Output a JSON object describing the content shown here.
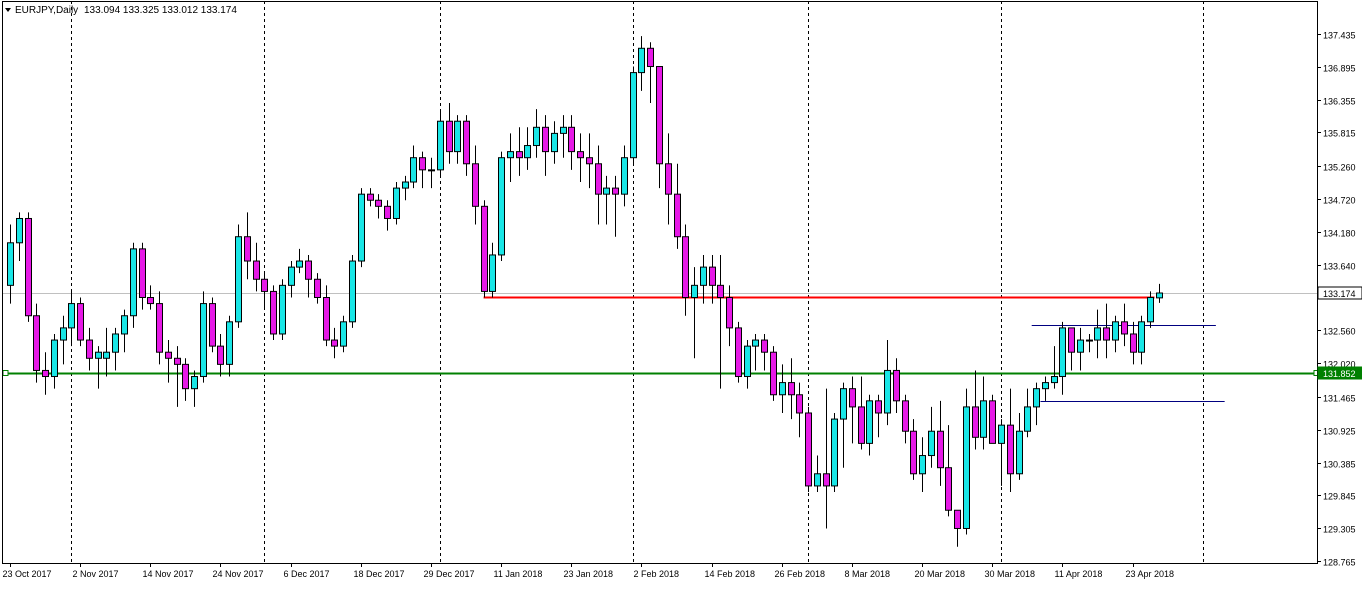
{
  "header": {
    "symbol_label": "EURJPY,Daily",
    "ohlc_label": "133.094 133.325 133.012 133.174"
  },
  "colors": {
    "bull_body": "#19e6e6",
    "bear_body": "#e619e6",
    "wick": "#000000",
    "grid": "#000000",
    "bid_line": "#c0c0c0",
    "red_level": "#ff0000",
    "green_level": "#008000",
    "blue_level": "#000080"
  },
  "chart_data": {
    "type": "candlestick",
    "symbol": "EURJPY",
    "timeframe": "Daily",
    "last_ohlc": {
      "open": 133.094,
      "high": 133.325,
      "low": 133.012,
      "close": 133.174
    },
    "ylim": [
      128.7,
      137.7
    ],
    "y_ticks": [
      "137.435",
      "136.895",
      "136.355",
      "135.815",
      "135.260",
      "134.720",
      "134.180",
      "133.640",
      "133.174",
      "132.560",
      "132.020",
      "131.852",
      "131.465",
      "130.925",
      "130.385",
      "129.845",
      "129.305",
      "128.765"
    ],
    "x_labels": [
      {
        "bar": 0,
        "label": "23 Oct 2017"
      },
      {
        "bar": 8,
        "label": "2 Nov 2017"
      },
      {
        "bar": 16,
        "label": "14 Nov 2017"
      },
      {
        "bar": 24,
        "label": "24 Nov 2017"
      },
      {
        "bar": 32,
        "label": "6 Dec 2017"
      },
      {
        "bar": 40,
        "label": "18 Dec 2017"
      },
      {
        "bar": 48,
        "label": "29 Dec 2017"
      },
      {
        "bar": 56,
        "label": "11 Jan 2018"
      },
      {
        "bar": 64,
        "label": "23 Jan 2018"
      },
      {
        "bar": 72,
        "label": "2 Feb 2018"
      },
      {
        "bar": 80,
        "label": "14 Feb 2018"
      },
      {
        "bar": 88,
        "label": "26 Feb 2018"
      },
      {
        "bar": 96,
        "label": "8 Mar 2018"
      },
      {
        "bar": 104,
        "label": "20 Mar 2018"
      },
      {
        "bar": 112,
        "label": "30 Mar 2018"
      },
      {
        "bar": 120,
        "label": "11 Apr 2018"
      },
      {
        "bar": 128,
        "label": "23 Apr 2018"
      }
    ],
    "period_separators": [
      7,
      29,
      49,
      71,
      91,
      113,
      136
    ],
    "price_labels": [
      {
        "value": 133.174,
        "text": "133.174",
        "style": "bid"
      },
      {
        "value": 131.852,
        "text": "131.852",
        "style": "green"
      }
    ],
    "horizontal_lines": [
      {
        "name": "red-resistance",
        "value": 133.11,
        "from_bar": 54,
        "to_bar": 130.5,
        "color": "red"
      },
      {
        "name": "green-support",
        "value": 131.852,
        "full_width": true,
        "color": "green"
      },
      {
        "name": "blue-range-top",
        "value": 132.64,
        "from_bar": 116.5,
        "to_bar": 137.5,
        "color": "blue"
      },
      {
        "name": "blue-range-bottom",
        "value": 131.4,
        "from_bar": 117.5,
        "to_bar": 138.5,
        "color": "blue"
      }
    ],
    "candles": [
      [
        133.3,
        134.3,
        133.0,
        134.0
      ],
      [
        134.0,
        134.5,
        133.7,
        134.4
      ],
      [
        134.4,
        134.5,
        132.7,
        132.8
      ],
      [
        132.8,
        133.0,
        131.7,
        131.9
      ],
      [
        131.9,
        132.2,
        131.5,
        131.8
      ],
      [
        131.8,
        132.5,
        131.6,
        132.4
      ],
      [
        132.4,
        132.8,
        132.0,
        132.6
      ],
      [
        132.6,
        133.2,
        132.3,
        133.0
      ],
      [
        133.0,
        133.1,
        132.3,
        132.4
      ],
      [
        132.4,
        132.6,
        131.9,
        132.1
      ],
      [
        132.1,
        132.3,
        131.6,
        132.2
      ],
      [
        132.1,
        132.6,
        131.8,
        132.2
      ],
      [
        132.2,
        132.6,
        131.9,
        132.5
      ],
      [
        132.5,
        132.9,
        132.2,
        132.8
      ],
      [
        132.8,
        134.0,
        132.6,
        133.9
      ],
      [
        133.9,
        134.0,
        132.9,
        133.1
      ],
      [
        133.1,
        133.3,
        132.9,
        133.0
      ],
      [
        133.0,
        133.2,
        132.0,
        132.2
      ],
      [
        132.2,
        132.4,
        131.7,
        132.1
      ],
      [
        132.1,
        132.3,
        131.3,
        132.0
      ],
      [
        132.0,
        132.1,
        131.4,
        131.6
      ],
      [
        131.6,
        131.9,
        131.3,
        131.8
      ],
      [
        131.8,
        133.2,
        131.7,
        133.0
      ],
      [
        133.0,
        133.1,
        132.2,
        132.3
      ],
      [
        132.3,
        132.5,
        131.8,
        132.0
      ],
      [
        132.0,
        132.8,
        131.8,
        132.7
      ],
      [
        132.7,
        134.3,
        132.6,
        134.1
      ],
      [
        134.1,
        134.5,
        133.4,
        133.7
      ],
      [
        133.7,
        134.0,
        133.2,
        133.4
      ],
      [
        133.4,
        133.5,
        132.9,
        133.2
      ],
      [
        133.2,
        133.3,
        132.4,
        132.5
      ],
      [
        132.5,
        133.4,
        132.4,
        133.3
      ],
      [
        133.3,
        133.7,
        133.1,
        133.6
      ],
      [
        133.6,
        133.9,
        133.5,
        133.7
      ],
      [
        133.7,
        133.8,
        133.1,
        133.4
      ],
      [
        133.4,
        133.5,
        133.0,
        133.1
      ],
      [
        133.1,
        133.3,
        132.3,
        132.4
      ],
      [
        132.4,
        132.6,
        132.1,
        132.3
      ],
      [
        132.3,
        132.8,
        132.2,
        132.7
      ],
      [
        132.7,
        133.8,
        132.6,
        133.7
      ],
      [
        133.7,
        134.9,
        133.6,
        134.8
      ],
      [
        134.8,
        134.9,
        134.6,
        134.7
      ],
      [
        134.7,
        134.8,
        134.4,
        134.6
      ],
      [
        134.6,
        134.7,
        134.2,
        134.4
      ],
      [
        134.4,
        135.0,
        134.3,
        134.9
      ],
      [
        134.9,
        135.1,
        134.7,
        135.0
      ],
      [
        135.0,
        135.6,
        134.9,
        135.4
      ],
      [
        135.4,
        135.5,
        134.9,
        135.2
      ],
      [
        135.2,
        135.4,
        134.9,
        135.2
      ],
      [
        135.2,
        136.2,
        135.1,
        136.0
      ],
      [
        136.0,
        136.3,
        135.3,
        135.5
      ],
      [
        135.5,
        136.1,
        135.3,
        136.0
      ],
      [
        136.0,
        136.1,
        135.1,
        135.3
      ],
      [
        135.3,
        135.6,
        134.3,
        134.6
      ],
      [
        134.6,
        134.7,
        133.1,
        133.2
      ],
      [
        133.2,
        134.0,
        133.1,
        133.8
      ],
      [
        133.8,
        135.5,
        133.7,
        135.4
      ],
      [
        135.4,
        135.8,
        135.0,
        135.5
      ],
      [
        135.5,
        135.9,
        135.1,
        135.4
      ],
      [
        135.4,
        135.9,
        135.2,
        135.6
      ],
      [
        135.6,
        136.2,
        135.4,
        135.9
      ],
      [
        135.9,
        136.1,
        135.1,
        135.5
      ],
      [
        135.5,
        136.0,
        135.3,
        135.8
      ],
      [
        135.8,
        136.1,
        135.4,
        135.9
      ],
      [
        135.9,
        136.1,
        135.2,
        135.5
      ],
      [
        135.5,
        135.8,
        135.0,
        135.4
      ],
      [
        135.4,
        135.8,
        134.9,
        135.3
      ],
      [
        135.3,
        135.6,
        134.3,
        134.8
      ],
      [
        134.8,
        135.1,
        134.3,
        134.9
      ],
      [
        134.9,
        135.1,
        134.1,
        134.8
      ],
      [
        134.8,
        135.6,
        134.6,
        135.4
      ],
      [
        135.4,
        136.9,
        135.3,
        136.8
      ],
      [
        136.8,
        137.4,
        136.5,
        137.2
      ],
      [
        137.2,
        137.3,
        136.3,
        136.9
      ],
      [
        136.9,
        136.9,
        134.9,
        135.3
      ],
      [
        135.3,
        135.8,
        134.3,
        134.8
      ],
      [
        134.8,
        135.3,
        133.9,
        134.1
      ],
      [
        134.1,
        134.3,
        132.8,
        133.1
      ],
      [
        133.1,
        133.6,
        132.1,
        133.3
      ],
      [
        133.3,
        133.8,
        133.0,
        133.6
      ],
      [
        133.6,
        133.8,
        133.0,
        133.3
      ],
      [
        133.3,
        133.8,
        131.6,
        133.1
      ],
      [
        133.1,
        133.3,
        132.3,
        132.6
      ],
      [
        132.6,
        132.7,
        131.7,
        131.8
      ],
      [
        131.8,
        132.4,
        131.6,
        132.3
      ],
      [
        132.3,
        132.5,
        131.9,
        132.4
      ],
      [
        132.4,
        132.5,
        131.9,
        132.2
      ],
      [
        132.2,
        132.3,
        131.4,
        131.5
      ],
      [
        131.5,
        132.0,
        131.2,
        131.7
      ],
      [
        131.7,
        132.1,
        131.1,
        131.5
      ],
      [
        131.5,
        131.7,
        130.8,
        131.2
      ],
      [
        131.2,
        131.3,
        129.9,
        130.0
      ],
      [
        130.0,
        130.5,
        129.9,
        130.2
      ],
      [
        130.2,
        131.6,
        129.3,
        130.0
      ],
      [
        130.0,
        131.2,
        129.9,
        131.1
      ],
      [
        131.1,
        131.7,
        130.3,
        131.6
      ],
      [
        131.6,
        131.8,
        130.7,
        131.3
      ],
      [
        131.3,
        131.8,
        130.6,
        130.7
      ],
      [
        130.7,
        131.5,
        130.5,
        131.4
      ],
      [
        131.4,
        131.5,
        130.8,
        131.2
      ],
      [
        131.2,
        132.4,
        131.0,
        131.9
      ],
      [
        131.9,
        132.1,
        131.2,
        131.4
      ],
      [
        131.4,
        131.5,
        130.7,
        130.9
      ],
      [
        130.9,
        131.1,
        130.1,
        130.2
      ],
      [
        130.2,
        130.8,
        129.9,
        130.5
      ],
      [
        130.5,
        131.3,
        130.3,
        130.9
      ],
      [
        130.9,
        131.4,
        130.0,
        130.3
      ],
      [
        130.3,
        131.0,
        129.5,
        129.6
      ],
      [
        129.6,
        129.6,
        129.0,
        129.3
      ],
      [
        129.3,
        131.6,
        129.2,
        131.3
      ],
      [
        131.3,
        131.9,
        130.6,
        130.8
      ],
      [
        130.8,
        131.8,
        130.6,
        131.4
      ],
      [
        131.4,
        131.5,
        130.7,
        130.7
      ],
      [
        130.7,
        131.1,
        130.0,
        131.0
      ],
      [
        131.0,
        131.6,
        129.9,
        130.2
      ],
      [
        130.2,
        131.2,
        130.1,
        130.9
      ],
      [
        130.9,
        131.6,
        130.8,
        131.3
      ],
      [
        131.3,
        131.7,
        131.0,
        131.6
      ],
      [
        131.6,
        131.8,
        131.4,
        131.7
      ],
      [
        131.7,
        132.3,
        131.6,
        131.8
      ],
      [
        131.8,
        132.7,
        131.5,
        132.6
      ],
      [
        132.6,
        132.6,
        131.9,
        132.2
      ],
      [
        132.2,
        132.6,
        131.9,
        132.4
      ],
      [
        132.4,
        132.5,
        132.2,
        132.4
      ],
      [
        132.4,
        132.9,
        132.1,
        132.6
      ],
      [
        132.6,
        133.0,
        132.1,
        132.4
      ],
      [
        132.4,
        132.8,
        132.2,
        132.7
      ],
      [
        132.7,
        133.0,
        132.3,
        132.5
      ],
      [
        132.5,
        132.7,
        132.0,
        132.2
      ],
      [
        132.2,
        132.8,
        132.0,
        132.7
      ],
      [
        132.7,
        133.2,
        132.6,
        133.1
      ],
      [
        133.094,
        133.325,
        133.012,
        133.174
      ]
    ]
  }
}
